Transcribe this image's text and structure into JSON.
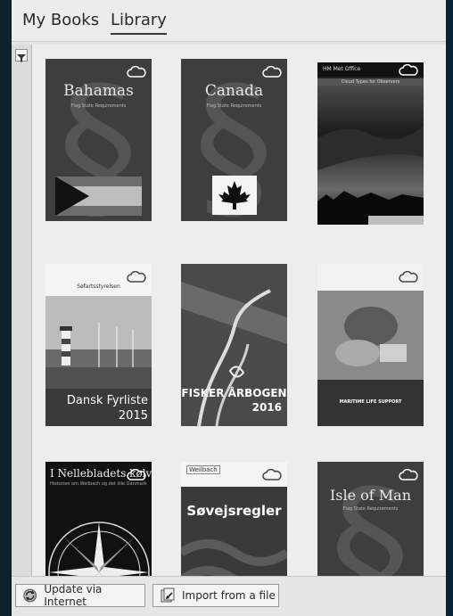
{
  "tabs": [
    {
      "label": "My Books"
    },
    {
      "label": "Library"
    }
  ],
  "books": [
    {
      "title": "Bahamas",
      "subtitle": "Flag State Requirements"
    },
    {
      "title": "Canada",
      "subtitle": "Flag State Requirements"
    },
    {
      "title": "HM Met Office",
      "subtitle": "Cloud Types for Observers"
    },
    {
      "title": "Dansk Fyrliste",
      "year": "2015",
      "publisher": "Søfartsstyrelsen"
    },
    {
      "title": "FISKER ÅRBOGEN",
      "year": "2016"
    },
    {
      "title": "MARITIME LIFE SUPPORT"
    },
    {
      "title": "I Nellebladets kølvand",
      "subtitle": "Historien om Weilbach og det lille Danmark"
    },
    {
      "title": "Søvejsregler",
      "publisher": "Weilbach"
    },
    {
      "title": "Isle of Man",
      "subtitle": "Flag State Requirements"
    }
  ],
  "footer": {
    "update_label": "Update via Internet",
    "import_label": "Import from a file"
  },
  "icons": {
    "filter": "filter-icon",
    "cloud": "cloud-icon",
    "update": "update-icon",
    "import": "import-icon"
  },
  "colors": {
    "frame": "#0d2230",
    "background": "#ededed",
    "cover_dark": "#3c3c3c"
  }
}
